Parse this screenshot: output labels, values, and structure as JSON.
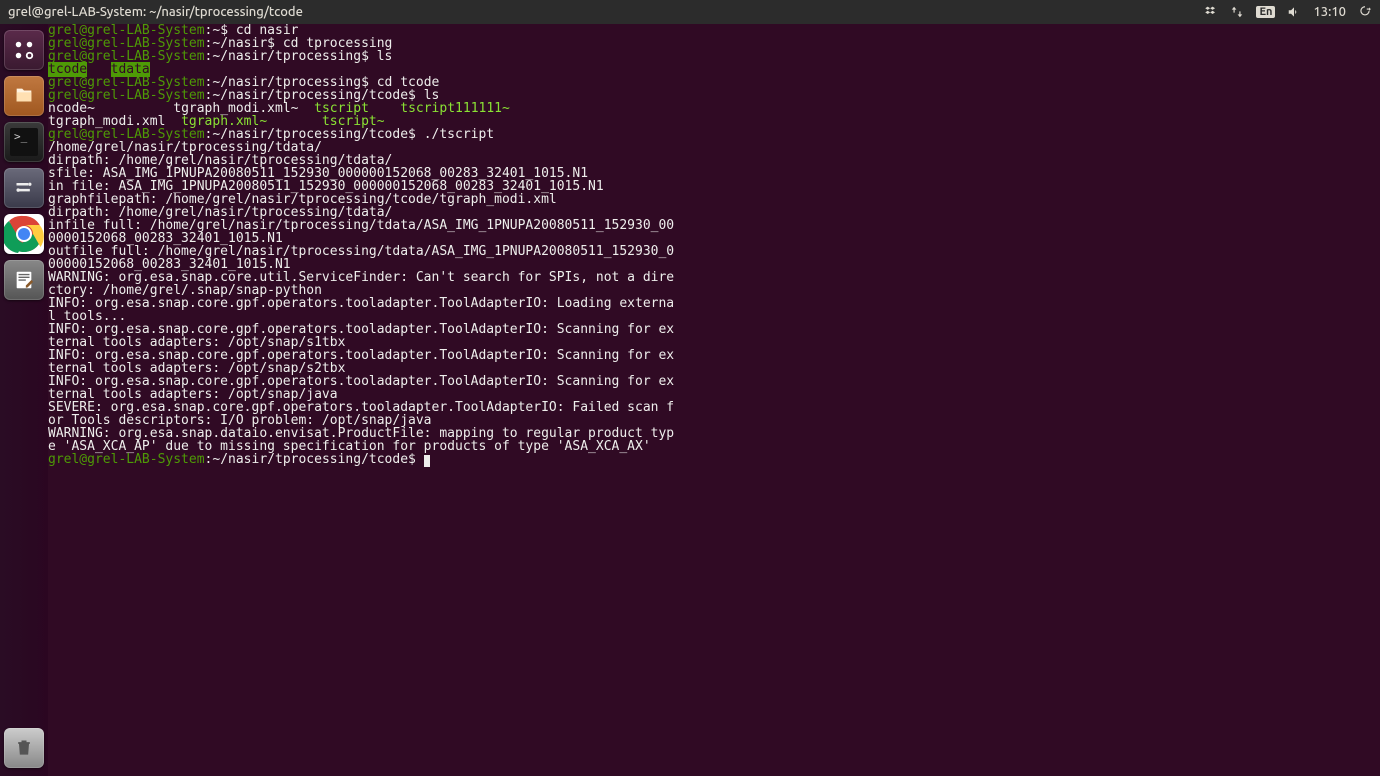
{
  "menubar": {
    "title": "grel@grel-LAB-System: ~/nasir/tprocessing/tcode",
    "lang": "En",
    "time": "13:10"
  },
  "launcher": {
    "dash": "dash",
    "files": "files",
    "terminal": "terminal",
    "settings": "settings",
    "chrome": "chrome",
    "editor": "text-editor",
    "trash": "trash"
  },
  "terminal": {
    "prompt_user_host": "grel@grel-LAB-System",
    "lines": [
      {
        "t": "prompt",
        "path": "~",
        "cmd": "cd nasir"
      },
      {
        "t": "prompt",
        "path": "~/nasir",
        "cmd": "cd tprocessing"
      },
      {
        "t": "prompt",
        "path": "~/nasir/tprocessing",
        "cmd": "ls"
      },
      {
        "t": "ls-hl",
        "items": [
          "tcode",
          "tdata"
        ]
      },
      {
        "t": "prompt",
        "path": "~/nasir/tprocessing",
        "cmd": "cd tcode"
      },
      {
        "t": "prompt",
        "path": "~/nasir/tprocessing/tcode",
        "cmd": "ls"
      },
      {
        "t": "ls-row",
        "cells": [
          {
            "txt": "ncode~",
            "cls": ""
          },
          {
            "pad": 10
          },
          {
            "txt": "tgraph_modi.xml~",
            "cls": ""
          },
          {
            "pad": 2
          },
          {
            "txt": "tscript",
            "cls": "c-bgreen"
          },
          {
            "pad": 4
          },
          {
            "txt": "tscript111111~",
            "cls": "c-bgreen"
          }
        ]
      },
      {
        "t": "ls-row",
        "cells": [
          {
            "txt": "tgraph_modi.xml",
            "cls": ""
          },
          {
            "pad": 2
          },
          {
            "txt": "tgraph.xml~",
            "cls": "c-bgreen"
          },
          {
            "pad": 7
          },
          {
            "txt": "tscript~",
            "cls": "c-bgreen"
          }
        ]
      },
      {
        "t": "prompt",
        "path": "~/nasir/tprocessing/tcode",
        "cmd": "./tscript"
      },
      {
        "t": "out",
        "txt": "/home/grel/nasir/tprocessing/tdata/"
      },
      {
        "t": "out",
        "txt": "dirpath: /home/grel/nasir/tprocessing/tdata/"
      },
      {
        "t": "out",
        "txt": "sfile: ASA_IMG_1PNUPA20080511_152930_000000152068_00283_32401_1015.N1"
      },
      {
        "t": "out",
        "txt": "in file: ASA_IMG_1PNUPA20080511_152930_000000152068_00283_32401_1015.N1"
      },
      {
        "t": "out",
        "txt": "graphfilepath: /home/grel/nasir/tprocessing/tcode/tgraph_modi.xml"
      },
      {
        "t": "out",
        "txt": "dirpath: /home/grel/nasir/tprocessing/tdata/"
      },
      {
        "t": "out",
        "txt": "infile full: /home/grel/nasir/tprocessing/tdata/ASA_IMG_1PNUPA20080511_152930_00"
      },
      {
        "t": "out",
        "txt": "0000152068_00283_32401_1015.N1"
      },
      {
        "t": "out",
        "txt": "outfile full: /home/grel/nasir/tprocessing/tdata/ASA_IMG_1PNUPA20080511_152930_0"
      },
      {
        "t": "out",
        "txt": "00000152068_00283_32401_1015.N1"
      },
      {
        "t": "out",
        "txt": "WARNING: org.esa.snap.core.util.ServiceFinder: Can't search for SPIs, not a dire"
      },
      {
        "t": "out",
        "txt": "ctory: /home/grel/.snap/snap-python"
      },
      {
        "t": "out",
        "txt": "INFO: org.esa.snap.core.gpf.operators.tooladapter.ToolAdapterIO: Loading externa"
      },
      {
        "t": "out",
        "txt": "l tools..."
      },
      {
        "t": "out",
        "txt": "INFO: org.esa.snap.core.gpf.operators.tooladapter.ToolAdapterIO: Scanning for ex"
      },
      {
        "t": "out",
        "txt": "ternal tools adapters: /opt/snap/s1tbx"
      },
      {
        "t": "out",
        "txt": "INFO: org.esa.snap.core.gpf.operators.tooladapter.ToolAdapterIO: Scanning for ex"
      },
      {
        "t": "out",
        "txt": "ternal tools adapters: /opt/snap/s2tbx"
      },
      {
        "t": "out",
        "txt": "INFO: org.esa.snap.core.gpf.operators.tooladapter.ToolAdapterIO: Scanning for ex"
      },
      {
        "t": "out",
        "txt": "ternal tools adapters: /opt/snap/java"
      },
      {
        "t": "out",
        "txt": "SEVERE: org.esa.snap.core.gpf.operators.tooladapter.ToolAdapterIO: Failed scan f"
      },
      {
        "t": "out",
        "txt": "or Tools descriptors: I/O problem: /opt/snap/java"
      },
      {
        "t": "out",
        "txt": "WARNING: org.esa.snap.dataio.envisat.ProductFile: mapping to regular product typ"
      },
      {
        "t": "out",
        "txt": "e 'ASA_XCA_AP' due to missing specification for products of type 'ASA_XCA_AX'"
      },
      {
        "t": "prompt",
        "path": "~/nasir/tprocessing/tcode",
        "cmd": "",
        "cursor": true
      }
    ]
  }
}
